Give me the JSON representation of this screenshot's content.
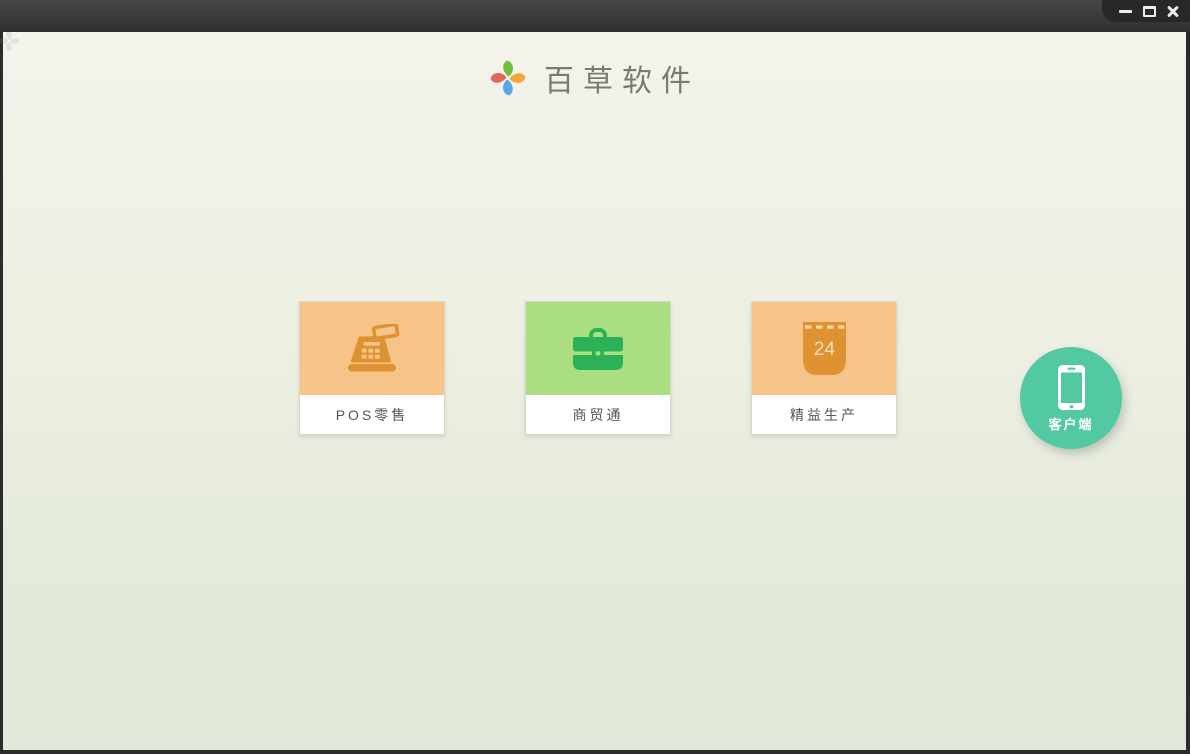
{
  "header": {
    "app_name": "百草软件",
    "logo_icon": "pinwheel-logo-icon"
  },
  "titlebar": {
    "controls": [
      {
        "name": "minimize",
        "icon": "minimize-icon"
      },
      {
        "name": "maximize",
        "icon": "maximize-icon"
      },
      {
        "name": "close",
        "icon": "close-icon"
      }
    ]
  },
  "products": [
    {
      "label": "POS零售",
      "icon": "cash-register-icon",
      "tile_color": "#f6c488",
      "icon_color": "#de9232"
    },
    {
      "label": "商贸通",
      "icon": "briefcase-icon",
      "tile_color": "#abde81",
      "icon_color": "#2bb259"
    },
    {
      "label": "精益生产",
      "icon": "calendar-icon",
      "calendar_day": "24",
      "tile_color": "#f6c488",
      "icon_color": "#de9232",
      "calendar_accent": "#f8d9a6",
      "calendar_day_color": "#f9e0b4"
    }
  ],
  "client_button": {
    "label": "客户端",
    "icon": "smartphone-icon",
    "color": "#52c9a2"
  },
  "colors": {
    "titlebar_top": "#474747",
    "titlebar_bottom": "#2e2e2e",
    "controls_tab": "#282828",
    "frame": "#2b2b2b",
    "bg_top": "#f4f3ec",
    "bg_bottom": "#dfe8d9",
    "card_label_text": "#54555a",
    "logo_text": "#797a70",
    "logo_petal_top": "#6fbf3d",
    "logo_petal_right": "#f5a53c",
    "logo_petal_bottom": "#5aa7e8",
    "logo_petal_left": "#e4685a"
  }
}
